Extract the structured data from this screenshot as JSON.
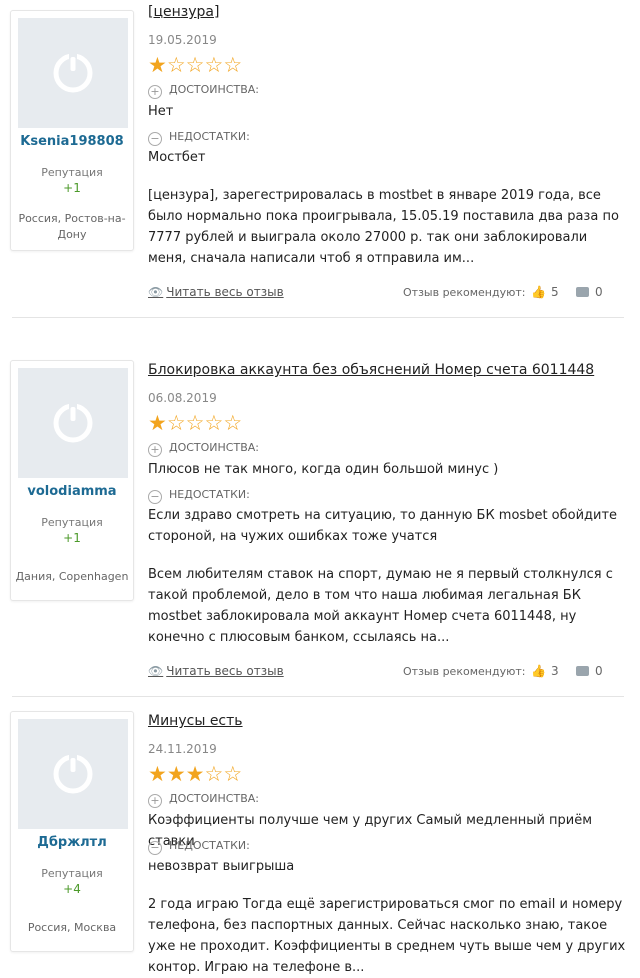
{
  "labels": {
    "pros": "ДОСТОИНСТВА:",
    "cons": "НЕДОСТАТКИ:",
    "reputation": "Репутация",
    "read_more": "Читать весь отзыв",
    "recommend": "Отзыв рекомендуют:"
  },
  "icons": {
    "plus": "+",
    "minus": "−",
    "eye": "eye-icon",
    "thumb": "thumbs-up-icon",
    "comment": "comment-icon"
  },
  "colors": {
    "star": "#f2a41e",
    "username": "#1d6a93",
    "reputation": "#4c9a2a",
    "avatar_bg": "#e7ebef"
  },
  "reviews": [
    {
      "user": "Ksenia198808",
      "reputation": "+1",
      "location": "Россия, Ростов-на-Дону",
      "title": "[цензура]",
      "date": "19.05.2019",
      "rating": 1,
      "pros": "Нет",
      "cons": "Мостбет",
      "body": "[цензура], зарегестрировалась в mostbet в январе 2019 года, все было нормально пока проигрывала, 15.05.19 поставила два раза по 7777 рублей и выиграла около 27000 р. так они заблокировали меня, сначала написали чтоб я отправила им...",
      "likes": "5",
      "comments": "0"
    },
    {
      "user": "volodiamma",
      "reputation": "+1",
      "location": "Дания, Copenhagen",
      "title": "Блокировка аккаунта без объяснений Номер счета 6011448",
      "date": "06.08.2019",
      "rating": 1,
      "pros": "Плюсов не так много, когда один большой минус )",
      "cons": "Если здраво смотреть на ситуацию, то данную БК mosbet обойдите стороной, на чужих ошибках тоже учатся",
      "body": "Всем любителям ставок на спорт, думаю не я первый столкнулся с такой проблемой, дело в том что наша любимая легальная БК mostbet заблокировала мой аккаунт Номер счета 6011448, ну конечно с плюсовым банком, ссылаясь на...",
      "likes": "3",
      "comments": "0"
    },
    {
      "user": "Дбржлтл",
      "reputation": "+4",
      "location": "Россия, Москва",
      "title": "Минусы есть",
      "date": "24.11.2019",
      "rating": 3,
      "pros": "Коэффициенты получше чем у других Самый медленный приём ставки",
      "cons": "невозврат выигрыша",
      "body": "2 года играю Тогда ещё зарегистрироваться смог по email и номеру телефона, без паспортных данных. Сейчас насколько знаю, такое уже не проходит. Коэффициенты в среднем чуть выше чем у других контор. Играю на телефоне в..."
    }
  ]
}
